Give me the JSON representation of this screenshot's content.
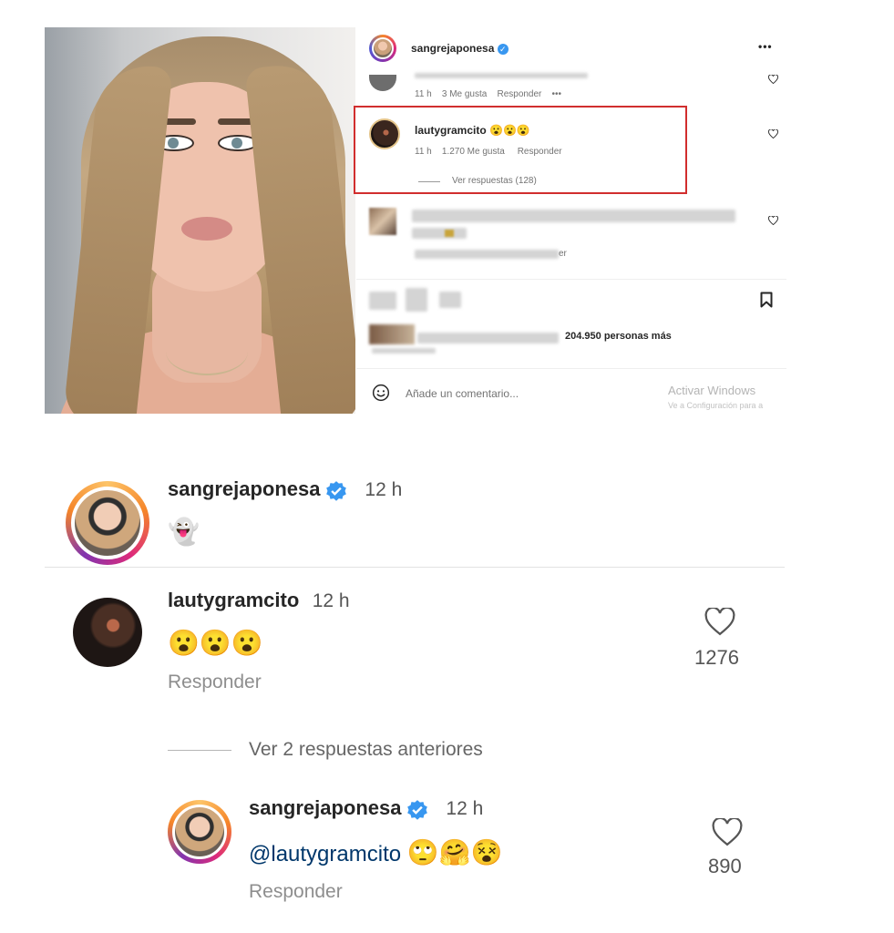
{
  "panel": {
    "header_user": "sangrejaponesa",
    "more_menu": "•••",
    "prev_comment": {
      "time": "11 h",
      "likes": "3 Me gusta",
      "reply": "Responder",
      "more": "•••"
    },
    "highlighted_comment": {
      "user": "lautygramcito",
      "text": "😮😮😮",
      "time": "11 h",
      "likes": "1.270 Me gusta",
      "reply": "Responder",
      "view_replies": "Ver respuestas (128)"
    },
    "blurred_fragment": "er",
    "liked_by_suffix": "204.950 personas más",
    "add_comment_placeholder": "Añade un comentario...",
    "watermark_title": "Activar Windows",
    "watermark_sub": "Ve a Configuración para a"
  },
  "thread": {
    "post": {
      "user": "sangrejaponesa",
      "time": "12 h",
      "text": "👻"
    },
    "comment": {
      "user": "lautygramcito",
      "time": "12 h",
      "text": "😮😮😮",
      "reply": "Responder",
      "likes": "1276"
    },
    "view_previous": "Ver 2 respuestas anteriores",
    "reply": {
      "user": "sangrejaponesa",
      "time": "12 h",
      "mention": "@lautygramcito",
      "emojis": "🙄🤗😵",
      "reply": "Responder",
      "likes": "890"
    }
  },
  "colors": {
    "highlight_border": "#d12e2e",
    "verified_blue": "#3897f0"
  }
}
